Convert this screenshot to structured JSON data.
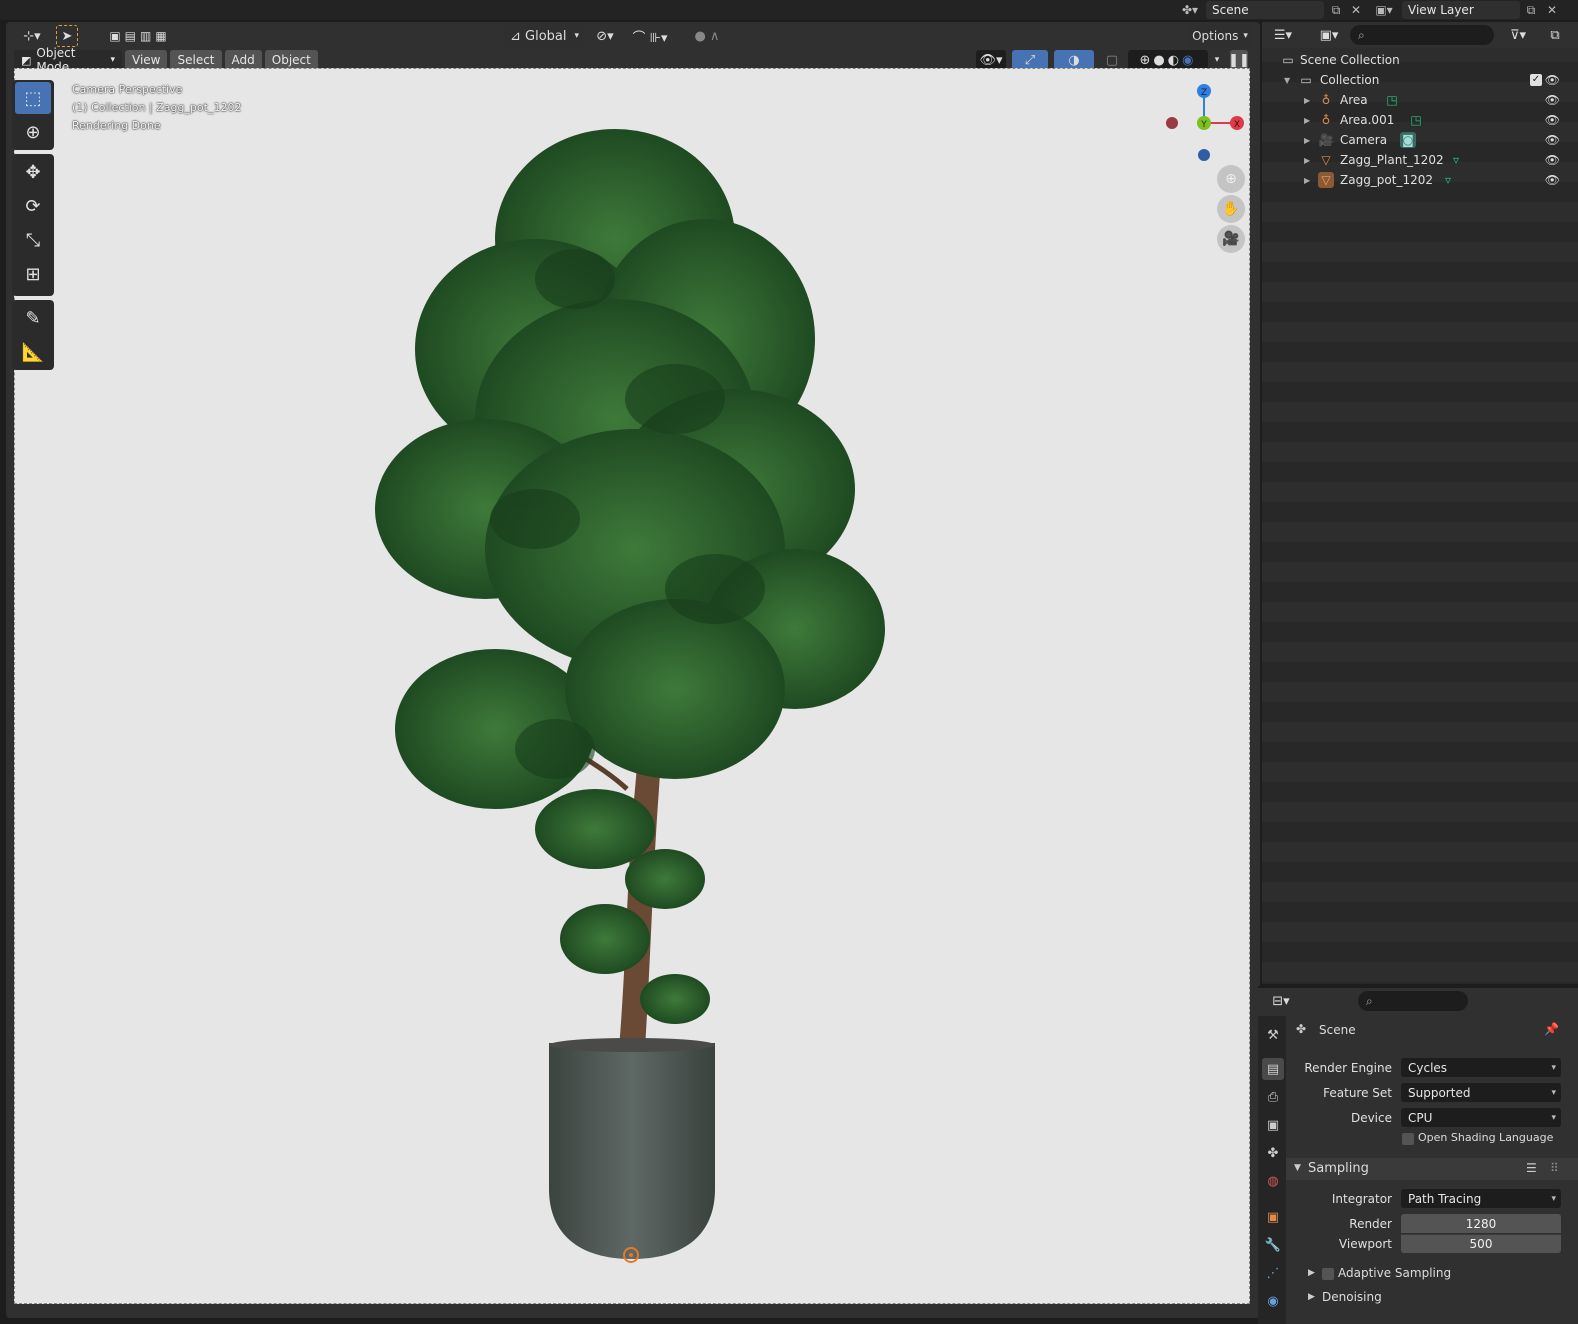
{
  "topbar": {
    "scene": "Scene",
    "view_layer": "View Layer"
  },
  "viewport": {
    "header": {
      "orientation": "Global",
      "options": "Options"
    },
    "menu": {
      "mode": "Object Mode",
      "view": "View",
      "select": "Select",
      "add": "Add",
      "object": "Object"
    },
    "overlay": {
      "line1": "Camera Perspective",
      "line2": "(1) Collection | Zagg_pot_1202",
      "line3": "Rendering Done"
    },
    "gizmo": {
      "z": "Z",
      "y": "Y",
      "x": "X"
    }
  },
  "outliner": {
    "scene_collection": "Scene Collection",
    "collection": "Collection",
    "items": [
      {
        "label": "Area"
      },
      {
        "label": "Area.001"
      },
      {
        "label": "Camera"
      },
      {
        "label": "Zagg_Plant_1202"
      },
      {
        "label": "Zagg_pot_1202"
      }
    ]
  },
  "properties": {
    "context": "Scene",
    "render_engine": {
      "label": "Render Engine",
      "value": "Cycles"
    },
    "feature_set": {
      "label": "Feature Set",
      "value": "Supported"
    },
    "device": {
      "label": "Device",
      "value": "CPU"
    },
    "osl": "Open Shading Language",
    "sampling": {
      "title": "Sampling",
      "integrator": {
        "label": "Integrator",
        "value": "Path Tracing"
      },
      "render": {
        "label": "Render",
        "value": "1280"
      },
      "viewport": {
        "label": "Viewport",
        "value": "500"
      },
      "adaptive": "Adaptive Sampling",
      "denoising": "Denoising"
    }
  },
  "colors": {
    "accent": "#4772b3",
    "axis_x": "#e03a48",
    "axis_y": "#7fbf1f",
    "axis_z": "#2f7fe0",
    "outliner_object": "#e38a4b",
    "mesh_data": "#22c27d"
  }
}
